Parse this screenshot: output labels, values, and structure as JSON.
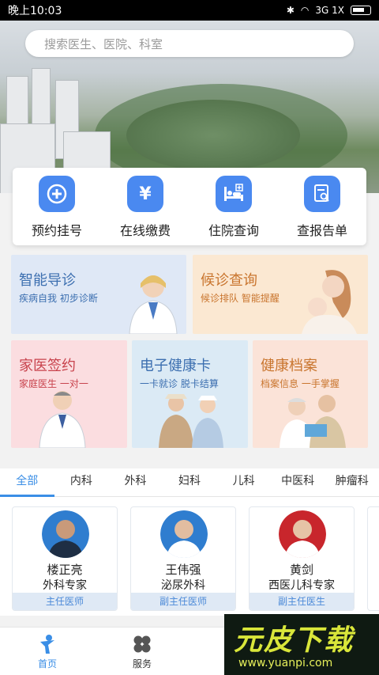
{
  "status_bar": {
    "time": "晚上10:03",
    "network": "3G 1X"
  },
  "search": {
    "placeholder": "搜索医生、医院、科室"
  },
  "quick_actions": [
    {
      "label": "预约挂号",
      "icon": "plus-circle-icon"
    },
    {
      "label": "在线缴费",
      "icon": "yen-icon"
    },
    {
      "label": "住院查询",
      "icon": "hospital-bed-icon"
    },
    {
      "label": "查报告单",
      "icon": "report-search-icon"
    }
  ],
  "services": [
    {
      "title": "智能导诊",
      "subtitle": "疾病自我 初步诊断"
    },
    {
      "title": "候诊查询",
      "subtitle": "候诊排队 智能提醒"
    },
    {
      "title": "家医签约",
      "subtitle": "家庭医生 一对一"
    },
    {
      "title": "电子健康卡",
      "subtitle": "一卡就诊 脱卡结算"
    },
    {
      "title": "健康档案",
      "subtitle": "档案信息 一手掌握"
    }
  ],
  "tabs": [
    "全部",
    "内科",
    "外科",
    "妇科",
    "儿科",
    "中医科",
    "肿瘤科"
  ],
  "doctors": [
    {
      "name": "楼正亮",
      "department": "外科专家",
      "rank": "主任医师"
    },
    {
      "name": "王伟强",
      "department": "泌尿外科",
      "rank": "副主任医师"
    },
    {
      "name": "黄剑",
      "department": "西医儿科专家",
      "rank": "副主任医生"
    }
  ],
  "bottom_nav": [
    {
      "label": "首页",
      "active": true
    },
    {
      "label": "服务",
      "active": false
    }
  ],
  "watermark": {
    "text": "元皮下载",
    "url": "www.yuanpi.com"
  },
  "colors": {
    "accent": "#3a8ee6",
    "icon_bg": "#4a89f0"
  }
}
